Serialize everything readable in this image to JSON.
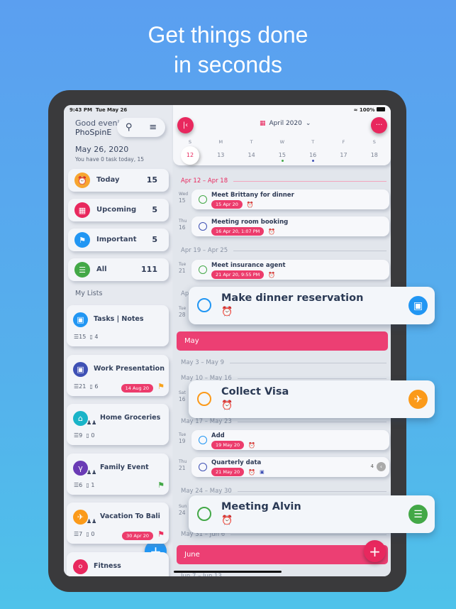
{
  "headline": {
    "line1": "Get things done",
    "line2": "in seconds"
  },
  "status": {
    "time": "9:43 PM",
    "date": "Tue May 26",
    "battery": "100%"
  },
  "sidebar": {
    "greeting": "Good evenin",
    "user": "PhoSpinE",
    "date": "May 26, 2020",
    "summary": "You have 0 task today, 15",
    "nav": [
      {
        "label": "Today",
        "count": "15",
        "icon": "alarm-clock-icon",
        "color": "#f7a530"
      },
      {
        "label": "Upcoming",
        "count": "5",
        "icon": "calendar-icon",
        "color": "#e8285e"
      },
      {
        "label": "Important",
        "count": "5",
        "icon": "flag-icon",
        "color": "#2196f3"
      },
      {
        "label": "All",
        "count": "111",
        "icon": "list-icon",
        "color": "#43a847"
      }
    ],
    "my_lists_label": "My Lists",
    "lists": [
      {
        "name": "Tasks | Notes",
        "tasks": "15",
        "notes": "4",
        "icon": "inbox-icon",
        "color": "#2196f3",
        "badge": "",
        "flag": "",
        "shared": false
      },
      {
        "name": "Work Presentation",
        "tasks": "21",
        "notes": "6",
        "icon": "briefcase-icon",
        "color": "#3f51b5",
        "badge": "14 Aug 20",
        "flag": "#f7a21b",
        "shared": false
      },
      {
        "name": "Home Groceries",
        "tasks": "9",
        "notes": "0",
        "icon": "home-icon",
        "color": "#1ab4c8",
        "badge": "",
        "flag": "",
        "shared": true
      },
      {
        "name": "Family Event",
        "tasks": "6",
        "notes": "1",
        "icon": "cocktail-icon",
        "color": "#6a3bb5",
        "badge": "",
        "flag": "#43a847",
        "shared": true
      },
      {
        "name": "Vacation To Bali",
        "tasks": "7",
        "notes": "0",
        "icon": "airplane-icon",
        "color": "#fb9a1a",
        "badge": "30 Apr 20",
        "flag": "#ec2d5e",
        "shared": true
      },
      {
        "name": "Fitness",
        "tasks": "",
        "notes": "",
        "icon": "bicycle-icon",
        "color": "#e8285e",
        "badge": "",
        "flag": "",
        "shared": false
      }
    ]
  },
  "calendar": {
    "month": "April 2020",
    "weekdays": [
      "S",
      "M",
      "T",
      "W",
      "T",
      "F",
      "S"
    ],
    "days": [
      "12",
      "13",
      "14",
      "15",
      "16",
      "17",
      "18"
    ],
    "selected": "12"
  },
  "agenda": {
    "w1": "Apr 12 – Apr 18",
    "w2": "Apr 19 – Apr 25",
    "w3": "Ap",
    "tasks": [
      {
        "dow": "Wed",
        "day": "15",
        "title": "Meet Brittany for dinner",
        "badge": "15 Apr 20",
        "color": "#43a847"
      },
      {
        "dow": "Thu",
        "day": "16",
        "title": "Meeting room booking",
        "badge": "16 Apr 20, 1:07 PM",
        "color": "#3f51b5"
      },
      {
        "dow": "Tue",
        "day": "21",
        "title": "Meet insurance agent",
        "badge": "21 Apr 20, 9:55 PM",
        "color": "#43a847"
      },
      {
        "dow": "Tue",
        "day": "19",
        "title": "Add",
        "badge": "19 May 20",
        "color": "#2196f3"
      },
      {
        "dow": "Thu",
        "day": "21",
        "title": "Quarterly data",
        "badge": "21 May 20",
        "color": "#3f51b5",
        "count": "4"
      }
    ],
    "hidden_days": [
      {
        "dow": "Tue",
        "day": "28"
      },
      {
        "dow": "Sat",
        "day": "16"
      },
      {
        "dow": "Sun",
        "day": "24"
      }
    ],
    "may": "May",
    "june": "June",
    "mw1": "May 3 – May 9",
    "mw2": "May 10 – May 16",
    "mw3": "May 17 – May 23",
    "mw4": "May 24 – May 30",
    "mw5": "May 31 – Jun 6",
    "jw1": "Jun 7 – Jun 13"
  },
  "popups": [
    {
      "title": "Make dinner reservation",
      "color": "#2196f3",
      "icon": "inbox-icon"
    },
    {
      "title": "Collect Visa",
      "color": "#fb9a1a",
      "icon": "airplane-icon"
    },
    {
      "title": "Meeting Alvin",
      "color": "#43a847",
      "icon": "food-icon"
    }
  ]
}
